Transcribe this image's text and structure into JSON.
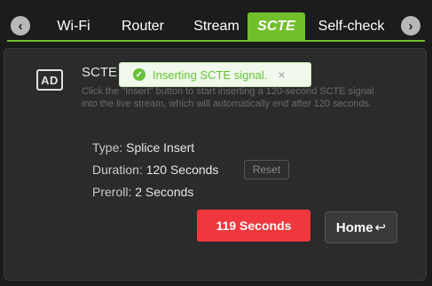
{
  "nav": {
    "tabs": [
      {
        "label": "Wi-Fi"
      },
      {
        "label": "Router"
      },
      {
        "label": "Stream"
      },
      {
        "label": "SCTE"
      },
      {
        "label": "Self-check"
      }
    ],
    "active_tab": "SCTE",
    "left_arrow": "‹",
    "right_arrow": "›"
  },
  "section": {
    "icon_text": "AD",
    "title": "SCTE",
    "description": "Click the \"Insert\" button to start inserting a 120-second SCTE signal into the live stream, which will automatically end after 120 seconds."
  },
  "toast": {
    "message": "Inserting SCTE signal.",
    "icon": "check-circle-icon",
    "close": "×"
  },
  "details": {
    "type_label": "Type:",
    "type_value": "Splice Insert",
    "duration_label": "Duration:",
    "duration_value": "120 Seconds",
    "reset_label": "Reset",
    "preroll_label": "Preroll:",
    "preroll_value": "2 Seconds"
  },
  "actions": {
    "countdown_label": "119 Seconds",
    "home_label": "Home",
    "home_icon": "↩"
  },
  "colors": {
    "accent": "#70bf2b",
    "danger": "#f0373e",
    "success": "#67c23a"
  }
}
